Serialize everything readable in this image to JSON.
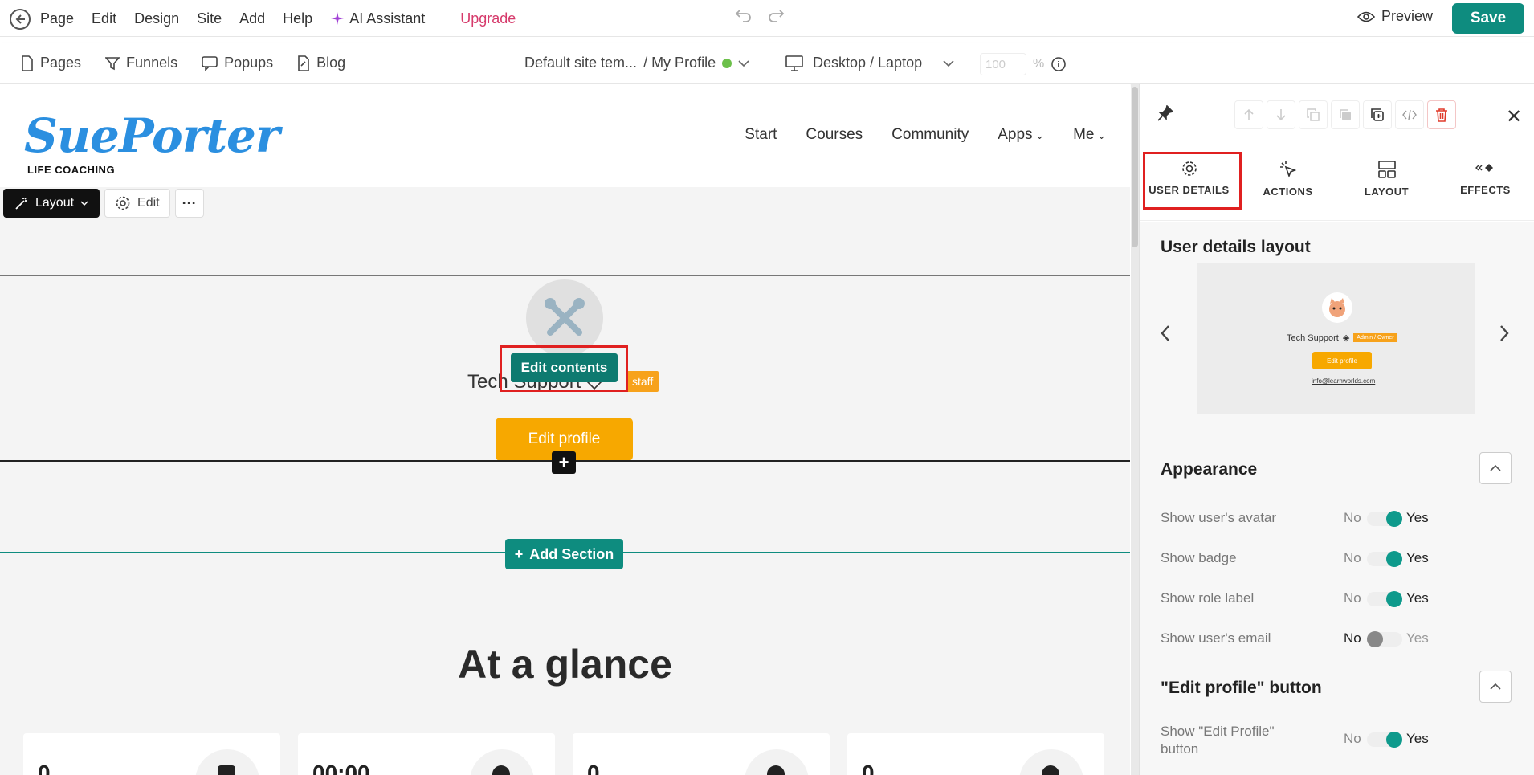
{
  "topbar": {
    "menu": [
      "Page",
      "Edit",
      "Design",
      "Site",
      "Add",
      "Help"
    ],
    "ai_label": "AI Assistant",
    "upgrade_label": "Upgrade",
    "preview_label": "Preview",
    "save_label": "Save"
  },
  "subbar": {
    "nav": [
      "Pages",
      "Funnels",
      "Popups",
      "Blog"
    ],
    "template": "Default site tem...",
    "page": "/ My Profile",
    "device": "Desktop / Laptop",
    "zoom_value": "100",
    "zoom_unit": "%"
  },
  "site": {
    "logo": "SuePorter",
    "logo_sub": "LIFE COACHING",
    "nav": [
      "Start",
      "Courses",
      "Community",
      "Apps",
      "Me"
    ]
  },
  "float_toolbar": {
    "layout": "Layout",
    "edit": "Edit",
    "more": "···"
  },
  "profile": {
    "name": "Tech Support",
    "badge": "staff",
    "edit_contents": "Edit contents",
    "edit_profile": "Edit profile",
    "plus": "+",
    "add_section": "Add Section"
  },
  "glance": {
    "title": "At a glance",
    "cards": [
      "0",
      "00:00",
      "0",
      "0"
    ]
  },
  "panel": {
    "tabs": [
      "USER DETAILS",
      "ACTIONS",
      "LAYOUT",
      "EFFECTS"
    ],
    "layout_title": "User details layout",
    "preview": {
      "name": "Tech Support",
      "badge": "Admin / Owner",
      "button": "Edit profile",
      "email": "info@learnworlds.com"
    },
    "appearance_title": "Appearance",
    "toggles": [
      {
        "label": "Show user's avatar",
        "no": "No",
        "yes": "Yes",
        "on": true
      },
      {
        "label": "Show badge",
        "no": "No",
        "yes": "Yes",
        "on": true
      },
      {
        "label": "Show role label",
        "no": "No",
        "yes": "Yes",
        "on": true
      },
      {
        "label": "Show user's email",
        "no": "No",
        "yes": "Yes",
        "on": false
      }
    ],
    "edit_btn_title": "\"Edit profile\" button",
    "edit_btn_toggle": {
      "label_1": "Show \"Edit Profile\"",
      "label_2": "button",
      "no": "No",
      "yes": "Yes",
      "on": true
    }
  },
  "colors": {
    "accent": "#0e8c7f",
    "ai": "#a241d6",
    "upgrade": "#d63a6b",
    "logo": "#2b8fe0",
    "orange": "#f7a800",
    "highlight": "#e02020"
  }
}
